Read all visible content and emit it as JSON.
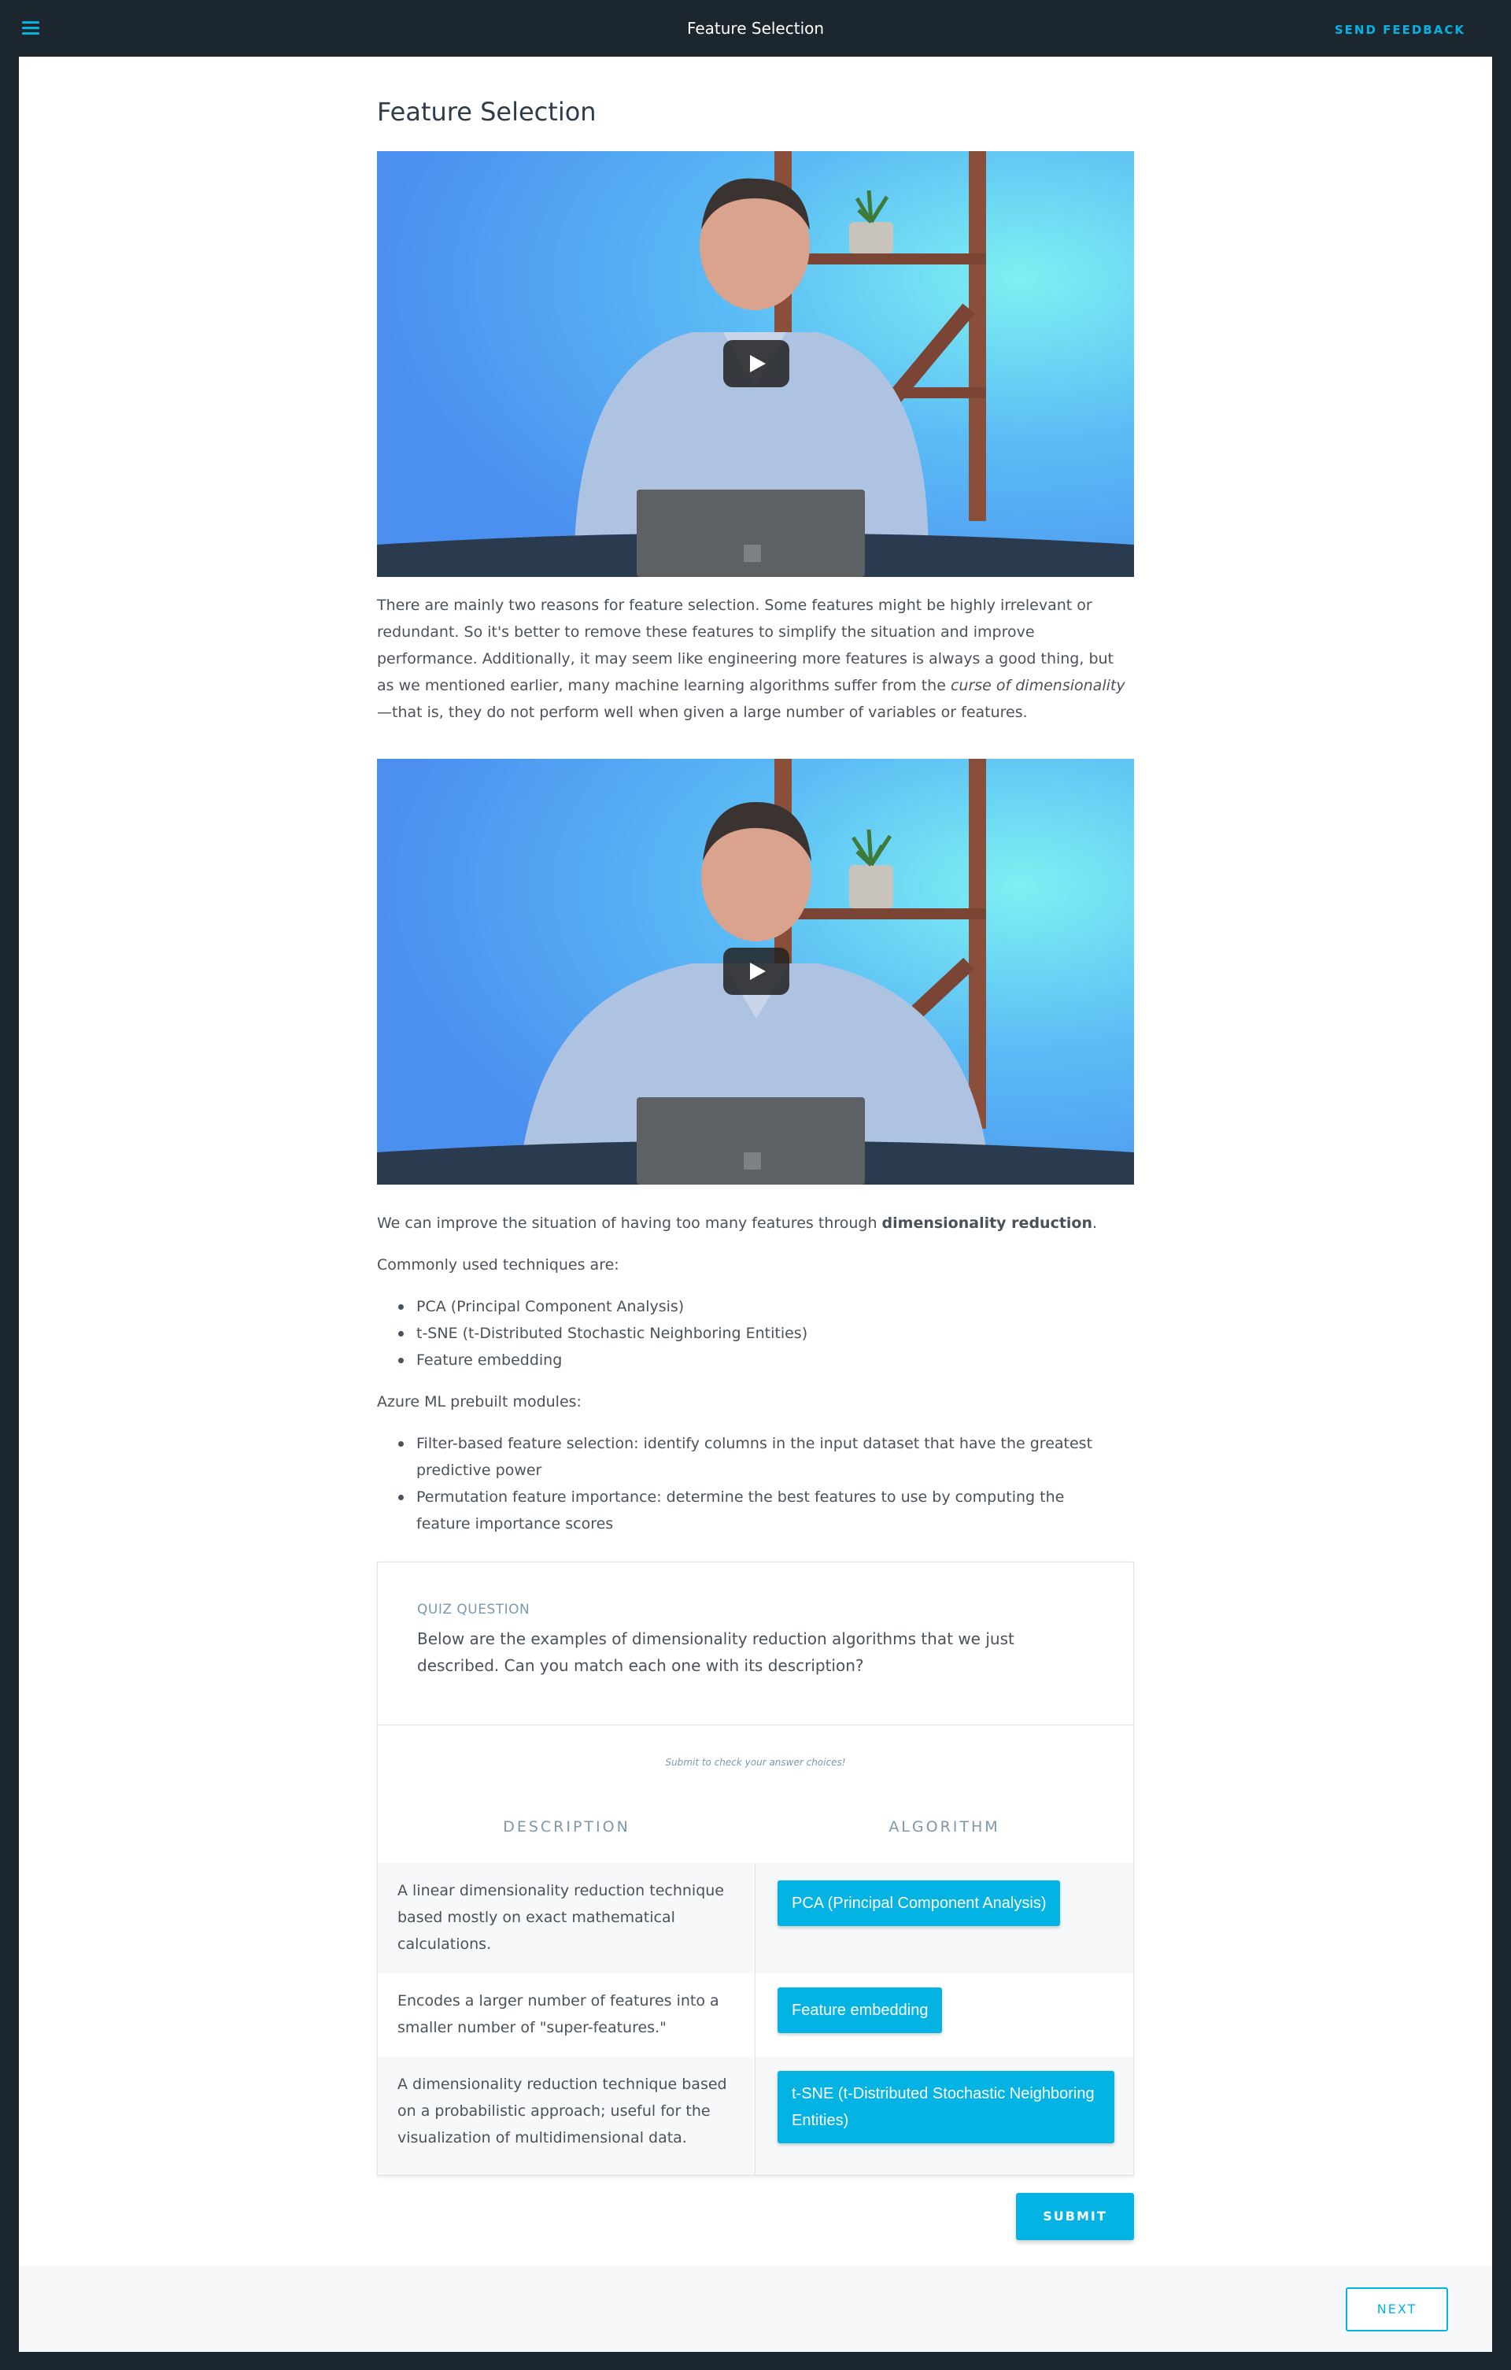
{
  "topbar": {
    "title": "Feature Selection",
    "feedback_label": "SEND FEEDBACK"
  },
  "page": {
    "title": "Feature Selection"
  },
  "paragraph1": {
    "text_before": "There are mainly two reasons for feature selection. Some features might be highly irrelevant or redundant. So it's better to remove these features to simplify the situation and improve performance. Additionally, it may seem like engineering more features is always a good thing, but as we mentioned earlier, many machine learning algorithms suffer from the ",
    "emphasis": "curse of dimensionality",
    "text_after": "—that is, they do not perform well when given a large number of variables or features."
  },
  "paragraph2": {
    "text_before": "We can improve the situation of having too many features through ",
    "strong": "dimensionality reduction",
    "text_after": "."
  },
  "techniques": {
    "intro": "Commonly used techniques are:",
    "items": [
      "PCA (Principal Component Analysis)",
      "t-SNE (t-Distributed Stochastic Neighboring Entities)",
      "Feature embedding"
    ]
  },
  "modules": {
    "intro": "Azure ML prebuilt modules:",
    "items": [
      "Filter-based feature selection: identify columns in the input dataset that have the greatest predictive power",
      "Permutation feature importance: determine the best features to use by computing the feature importance scores"
    ]
  },
  "quiz": {
    "eyebrow": "QUIZ QUESTION",
    "question": "Below are the examples of dimensionality reduction algorithms that we just described. Can you match each one with its description?",
    "hint": "Submit to check your answer choices!",
    "headers": {
      "description": "DESCRIPTION",
      "algorithm": "ALGORITHM"
    },
    "rows": [
      {
        "description": "A linear dimensionality reduction technique based mostly on exact mathematical calculations.",
        "algorithm": "PCA (Principal Component Analysis)"
      },
      {
        "description": "Encodes a larger number of features into a smaller number of \"super-features.\"",
        "algorithm": "Feature embedding"
      },
      {
        "description": "A dimensionality reduction technique based on a probabilistic approach; useful for the visualization of multidimensional data.",
        "algorithm": "t-SNE (t-Distributed Stochastic Neighboring Entities)"
      }
    ],
    "submit_label": "SUBMIT"
  },
  "footer": {
    "next_label": "NEXT"
  },
  "colors": {
    "accent": "#02b3e4",
    "topbar": "#1c262f",
    "text": "#4b5159",
    "muted": "#7d97ad"
  }
}
